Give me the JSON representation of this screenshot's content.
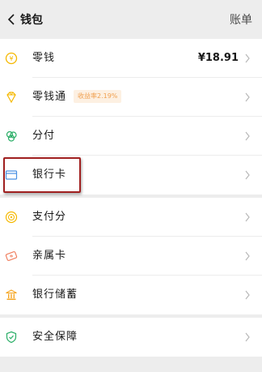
{
  "header": {
    "title": "钱包",
    "right_label": "账单"
  },
  "groups": [
    {
      "items": [
        {
          "label": "零钱",
          "value": "¥18.91",
          "icon": "coin-icon",
          "color": "#f5b800"
        },
        {
          "label": "零钱通",
          "badge": "收益率2.19%",
          "icon": "diamond-icon",
          "color": "#f5b800"
        },
        {
          "label": "分付",
          "icon": "clover-icon",
          "color": "#2aae67"
        },
        {
          "label": "银行卡",
          "icon": "card-icon",
          "color": "#4a90e2",
          "highlighted": true
        }
      ]
    },
    {
      "items": [
        {
          "label": "支付分",
          "icon": "score-icon",
          "color": "#f5b800"
        },
        {
          "label": "亲属卡",
          "icon": "family-card-icon",
          "color": "#f08060"
        },
        {
          "label": "银行储蓄",
          "icon": "bank-icon",
          "color": "#f5a623"
        }
      ]
    },
    {
      "items": [
        {
          "label": "安全保障",
          "icon": "shield-icon",
          "color": "#2aae67"
        }
      ]
    }
  ]
}
